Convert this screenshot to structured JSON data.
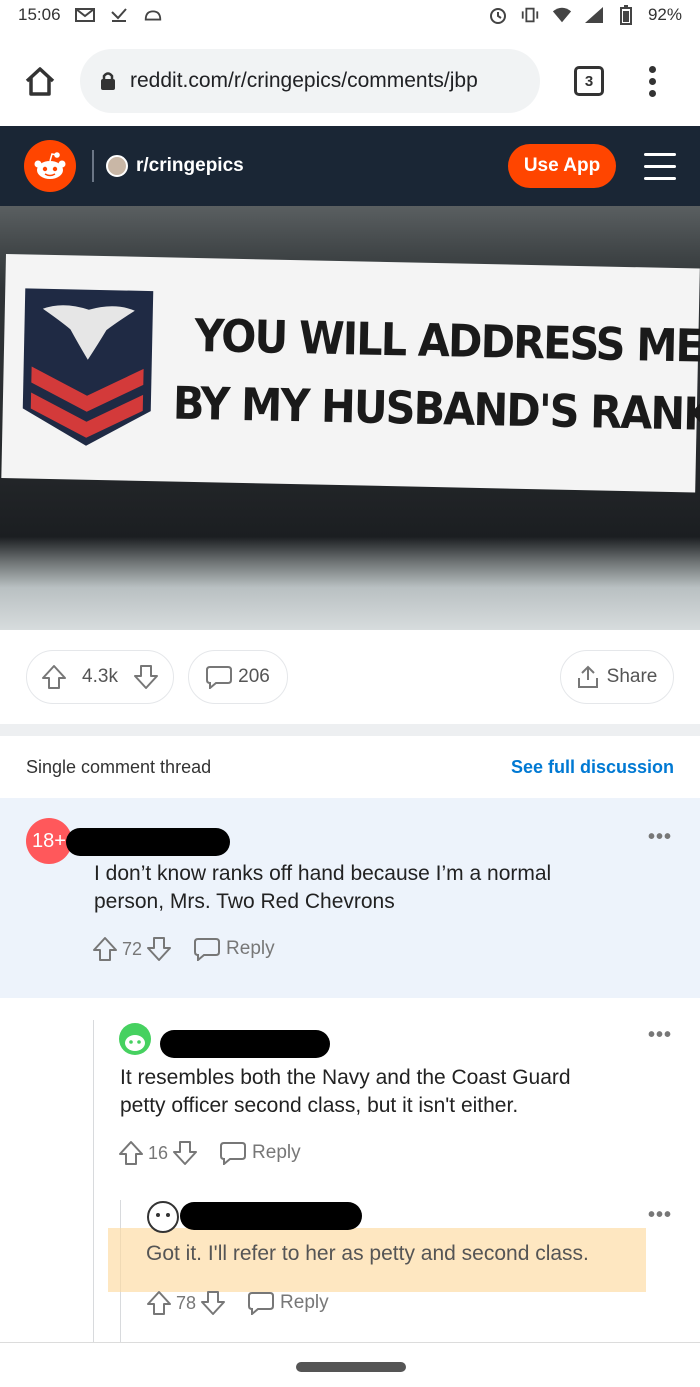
{
  "status_bar": {
    "time": "15:06",
    "battery": "92%"
  },
  "browser": {
    "url": "reddit.com/r/cringepics/comments/jbp",
    "tab_count": "3"
  },
  "reddit_header": {
    "subreddit": "r/cringepics",
    "use_app_label": "Use App"
  },
  "post": {
    "image_text_line1": "YOU WILL ADDRESS ME",
    "image_text_line2": "BY MY HUSBAND'S RANK",
    "score": "4.3k",
    "comments": "206",
    "share_label": "Share"
  },
  "thread": {
    "title": "Single comment thread",
    "see_full_label": "See full discussion"
  },
  "comments": [
    {
      "avatar_label": "18+",
      "text_line1": "I don’t know ranks off hand because I’m a normal",
      "text_line2": "person, Mrs. Two Red Chevrons",
      "score": "72",
      "reply_label": "Reply"
    },
    {
      "text_line1": "It resembles both the Navy and the Coast Guard",
      "text_line2": "petty officer second class, but it isn't either.",
      "score": "16",
      "reply_label": "Reply"
    },
    {
      "text": "Got it. I'll refer to her as petty and second class.",
      "score": "78",
      "reply_label": "Reply"
    }
  ],
  "colors": {
    "reddit_orange": "#ff4500",
    "header_bg": "#1a2635",
    "link_blue": "#0079d3",
    "highlight": "#fddaa0"
  }
}
